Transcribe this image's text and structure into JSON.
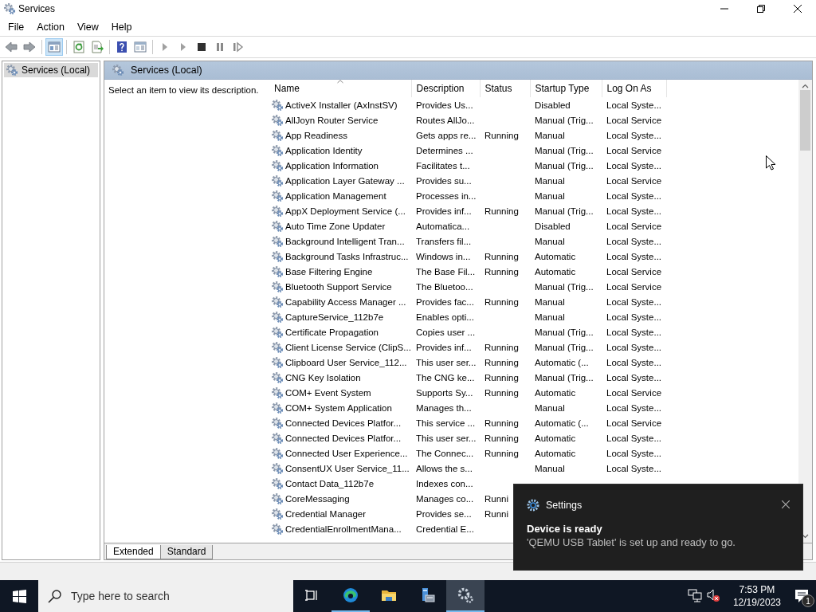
{
  "window": {
    "title": "Services"
  },
  "menu": [
    {
      "label": "File"
    },
    {
      "label": "Action"
    },
    {
      "label": "View"
    },
    {
      "label": "Help"
    }
  ],
  "toolbar": [
    {
      "kind": "back",
      "pressed": false
    },
    {
      "kind": "forward",
      "pressed": false
    },
    {
      "kind": "separator"
    },
    {
      "kind": "console-tree",
      "pressed": true
    },
    {
      "kind": "separator"
    },
    {
      "kind": "refresh",
      "pressed": false
    },
    {
      "kind": "export",
      "pressed": false
    },
    {
      "kind": "separator"
    },
    {
      "kind": "help",
      "pressed": false
    },
    {
      "kind": "properties",
      "pressed": false
    },
    {
      "kind": "separator"
    },
    {
      "kind": "start",
      "pressed": false
    },
    {
      "kind": "start",
      "pressed": false
    },
    {
      "kind": "stop",
      "pressed": false
    },
    {
      "kind": "pause",
      "pressed": false
    },
    {
      "kind": "resume",
      "pressed": false
    }
  ],
  "tree": [
    {
      "label": "Services (Local)",
      "selected": true
    }
  ],
  "panel": {
    "title": "Services (Local)",
    "description": "Select an item to view its description."
  },
  "table": {
    "columns": [
      {
        "label": "Name",
        "sorted": true
      },
      {
        "label": "Description",
        "sorted": false
      },
      {
        "label": "Status",
        "sorted": false
      },
      {
        "label": "Startup Type",
        "sorted": false
      },
      {
        "label": "Log On As",
        "sorted": false
      }
    ],
    "rows": [
      {
        "name": "ActiveX Installer (AxInstSV)",
        "description": "Provides Us...",
        "startup_type": "Disabled",
        "log_on_as": "Local Syste..."
      },
      {
        "name": "AllJoyn Router Service",
        "description": "Routes AllJo...",
        "startup_type": "Manual (Trig...",
        "log_on_as": "Local Service"
      },
      {
        "name": "App Readiness",
        "description": "Gets apps re...",
        "status": "Running",
        "startup_type": "Manual",
        "log_on_as": "Local Syste..."
      },
      {
        "name": "Application Identity",
        "description": "Determines ...",
        "startup_type": "Manual (Trig...",
        "log_on_as": "Local Service"
      },
      {
        "name": "Application Information",
        "description": "Facilitates t...",
        "startup_type": "Manual (Trig...",
        "log_on_as": "Local Syste..."
      },
      {
        "name": "Application Layer Gateway ...",
        "description": "Provides su...",
        "startup_type": "Manual",
        "log_on_as": "Local Service"
      },
      {
        "name": "Application Management",
        "description": "Processes in...",
        "startup_type": "Manual",
        "log_on_as": "Local Syste..."
      },
      {
        "name": "AppX Deployment Service (...",
        "description": "Provides inf...",
        "status": "Running",
        "startup_type": "Manual (Trig...",
        "log_on_as": "Local Syste..."
      },
      {
        "name": "Auto Time Zone Updater",
        "description": "Automatica...",
        "startup_type": "Disabled",
        "log_on_as": "Local Service"
      },
      {
        "name": "Background Intelligent Tran...",
        "description": "Transfers fil...",
        "startup_type": "Manual",
        "log_on_as": "Local Syste..."
      },
      {
        "name": "Background Tasks Infrastruc...",
        "description": "Windows in...",
        "status": "Running",
        "startup_type": "Automatic",
        "log_on_as": "Local Syste..."
      },
      {
        "name": "Base Filtering Engine",
        "description": "The Base Fil...",
        "status": "Running",
        "startup_type": "Automatic",
        "log_on_as": "Local Service"
      },
      {
        "name": "Bluetooth Support Service",
        "description": "The Bluetoo...",
        "startup_type": "Manual (Trig...",
        "log_on_as": "Local Service"
      },
      {
        "name": "Capability Access Manager ...",
        "description": "Provides fac...",
        "status": "Running",
        "startup_type": "Manual",
        "log_on_as": "Local Syste..."
      },
      {
        "name": "CaptureService_112b7e",
        "description": "Enables opti...",
        "startup_type": "Manual",
        "log_on_as": "Local Syste..."
      },
      {
        "name": "Certificate Propagation",
        "description": "Copies user ...",
        "startup_type": "Manual (Trig...",
        "log_on_as": "Local Syste..."
      },
      {
        "name": "Client License Service (ClipS...",
        "description": "Provides inf...",
        "status": "Running",
        "startup_type": "Manual (Trig...",
        "log_on_as": "Local Syste..."
      },
      {
        "name": "Clipboard User Service_112...",
        "description": "This user ser...",
        "status": "Running",
        "startup_type": "Automatic (...",
        "log_on_as": "Local Syste..."
      },
      {
        "name": "CNG Key Isolation",
        "description": "The CNG ke...",
        "status": "Running",
        "startup_type": "Manual (Trig...",
        "log_on_as": "Local Syste..."
      },
      {
        "name": "COM+ Event System",
        "description": "Supports Sy...",
        "status": "Running",
        "startup_type": "Automatic",
        "log_on_as": "Local Service"
      },
      {
        "name": "COM+ System Application",
        "description": "Manages th...",
        "startup_type": "Manual",
        "log_on_as": "Local Syste..."
      },
      {
        "name": "Connected Devices Platfor...",
        "description": "This service ...",
        "status": "Running",
        "startup_type": "Automatic (...",
        "log_on_as": "Local Service"
      },
      {
        "name": "Connected Devices Platfor...",
        "description": "This user ser...",
        "status": "Running",
        "startup_type": "Automatic",
        "log_on_as": "Local Syste..."
      },
      {
        "name": "Connected User Experience...",
        "description": "The Connec...",
        "status": "Running",
        "startup_type": "Automatic",
        "log_on_as": "Local Syste..."
      },
      {
        "name": "ConsentUX User Service_11...",
        "description": "Allows the s...",
        "startup_type": "Manual",
        "log_on_as": "Local Syste..."
      },
      {
        "name": "Contact Data_112b7e",
        "description": "Indexes con..."
      },
      {
        "name": "CoreMessaging",
        "description": "Manages co...",
        "status": "Runni"
      },
      {
        "name": "Credential Manager",
        "description": "Provides se...",
        "status": "Runni"
      },
      {
        "name": "CredentialEnrollmentMana...",
        "description": "Credential E..."
      }
    ]
  },
  "view_tabs": [
    {
      "label": "Extended",
      "selected": true
    },
    {
      "label": "Standard",
      "selected": false
    }
  ],
  "toast": {
    "app": "Settings",
    "title": "Device is ready",
    "body": "'QEMU USB Tablet' is set up and ready to go."
  },
  "taskbar": {
    "search": {
      "placeholder": "Type here to search"
    },
    "apps": [
      {
        "kind": "task-view",
        "running": false,
        "selected": false
      },
      {
        "kind": "edge",
        "running": true,
        "selected": false
      },
      {
        "kind": "explorer",
        "running": false,
        "selected": false
      },
      {
        "kind": "server-manager",
        "running": false,
        "selected": false
      },
      {
        "kind": "services",
        "running": true,
        "selected": true
      }
    ],
    "time": "7:53 PM",
    "date": "12/19/2023",
    "notifications": "1"
  }
}
